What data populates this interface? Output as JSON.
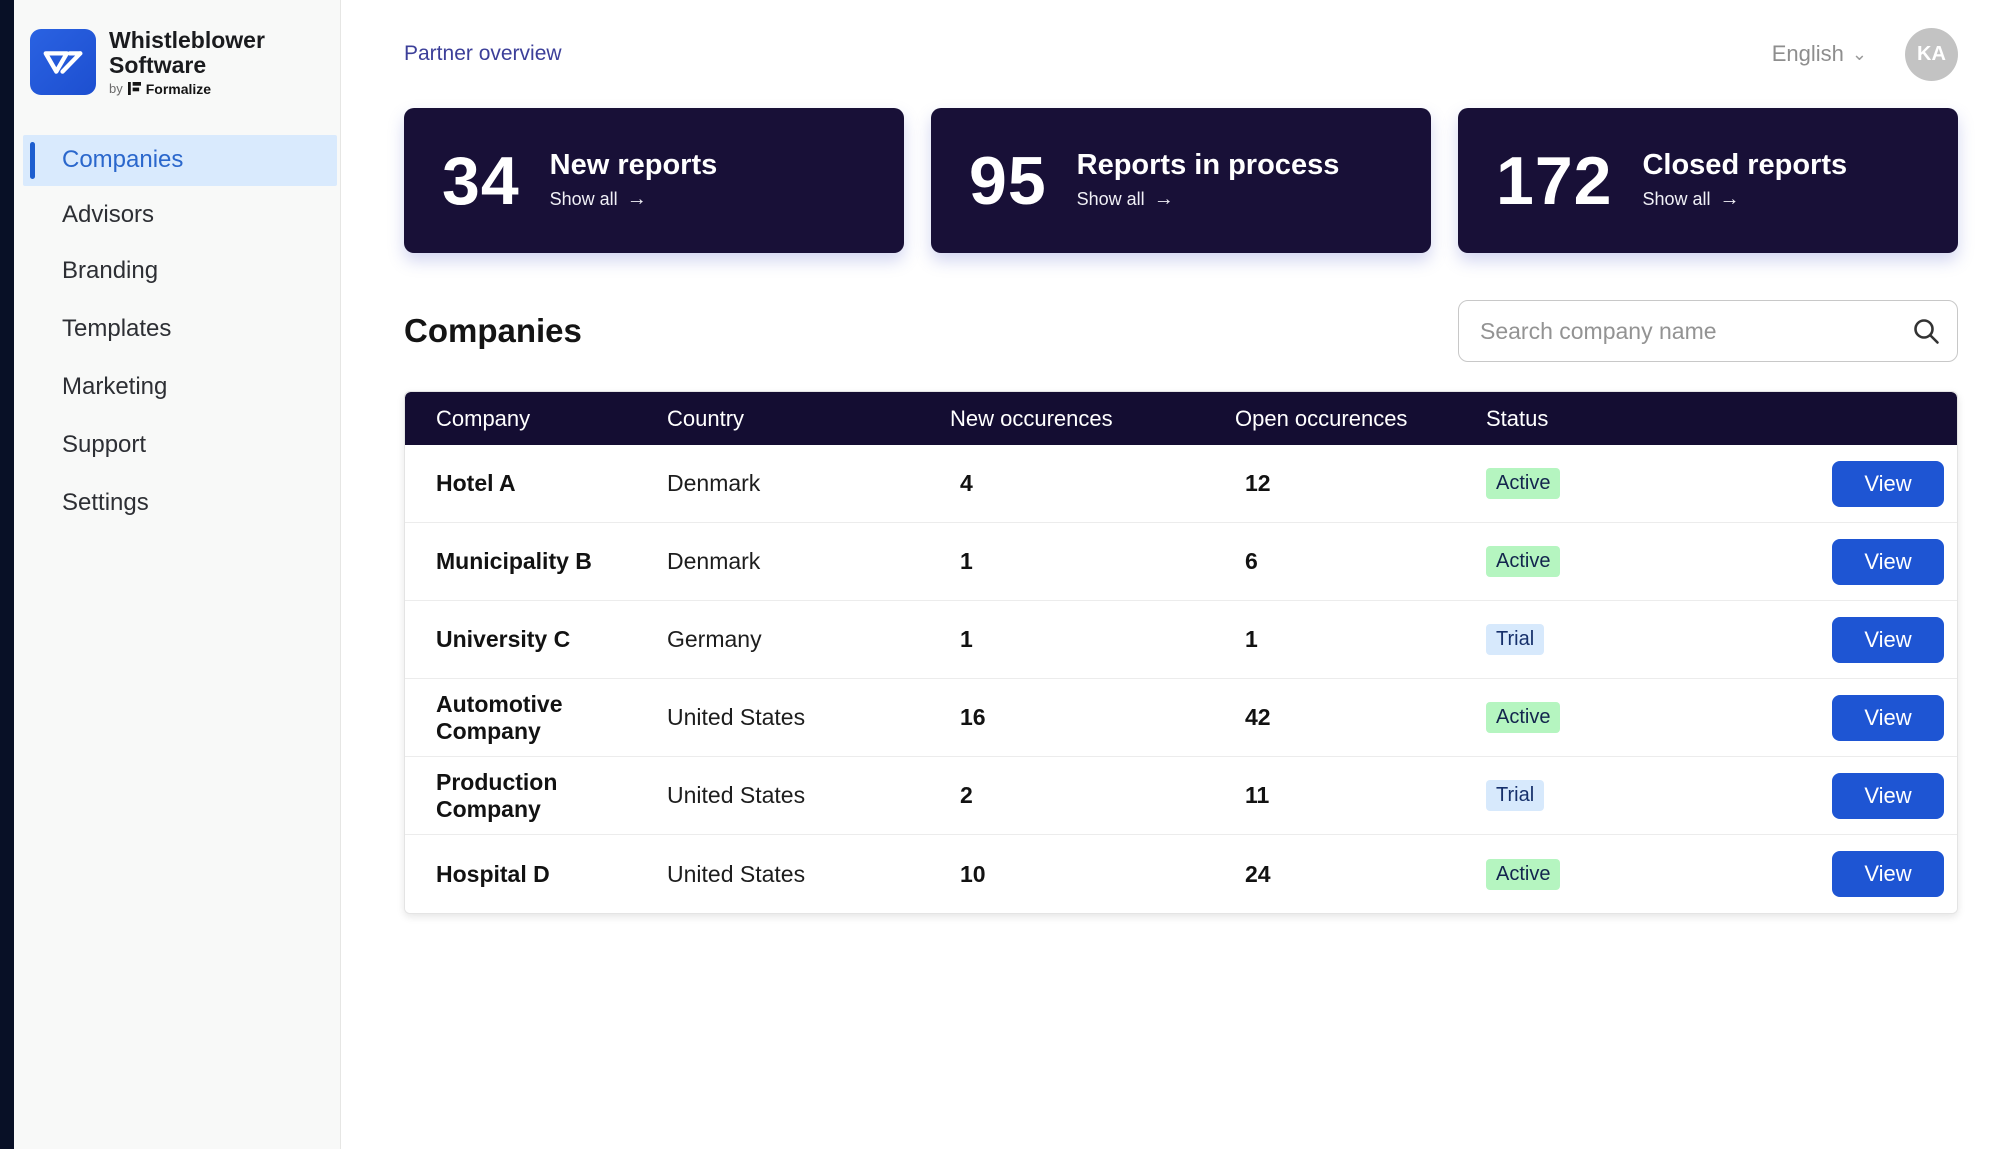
{
  "brand": {
    "name_line1": "Whistleblower",
    "name_line2": "Software",
    "by_label": "by",
    "by_brand": "Formalize"
  },
  "header": {
    "breadcrumb": "Partner overview",
    "language": "English",
    "avatar_initials": "KA"
  },
  "icons": {
    "chevron_down": "⌄",
    "arrow_right": "→"
  },
  "sidebar": {
    "items": [
      {
        "label": "Companies",
        "state": "active"
      },
      {
        "label": "Advisors",
        "state": ""
      },
      {
        "label": "Branding",
        "state": ""
      },
      {
        "label": "Templates",
        "state": ""
      },
      {
        "label": "Marketing",
        "state": ""
      },
      {
        "label": "Support",
        "state": ""
      },
      {
        "label": "Settings",
        "state": ""
      }
    ]
  },
  "stat_cards": [
    {
      "value": "34",
      "label": "New reports",
      "link": "Show all"
    },
    {
      "value": "95",
      "label": "Reports in process",
      "link": "Show all"
    },
    {
      "value": "172",
      "label": "Closed reports",
      "link": "Show all"
    }
  ],
  "companies_section": {
    "title": "Companies",
    "search_placeholder": "Search company name"
  },
  "table": {
    "columns": [
      "Company",
      "Country",
      "New occurences",
      "Open occurences",
      "Status"
    ],
    "rows": [
      {
        "company": "Hotel A",
        "country": "Denmark",
        "new_occurences": "4",
        "open_occurences": "12",
        "status": "Active",
        "action": "View"
      },
      {
        "company": "Municipality B",
        "country": "Denmark",
        "new_occurences": "1",
        "open_occurences": "6",
        "status": "Active",
        "action": "View"
      },
      {
        "company": "University C",
        "country": "Germany",
        "new_occurences": "1",
        "open_occurences": "1",
        "status": "Trial",
        "action": "View"
      },
      {
        "company": "Automotive Company",
        "country": "United States",
        "new_occurences": "16",
        "open_occurences": "42",
        "status": "Active",
        "action": "View"
      },
      {
        "company": "Production Company",
        "country": "United States",
        "new_occurences": "2",
        "open_occurences": "11",
        "status": "Trial",
        "action": "View"
      },
      {
        "company": "Hospital D",
        "country": "United States",
        "new_occurences": "10",
        "open_occurences": "24",
        "status": "Active",
        "action": "View"
      }
    ]
  },
  "colors": {
    "dark_navy": "#140d32",
    "card_navy": "#181037",
    "accent_blue": "#1e55d3",
    "sidebar_active_bg": "#d9eafd",
    "sidebar_active_text": "#2a67cc",
    "status_active_bg": "#b5f5c0",
    "status_trial_bg": "#d7e9fc",
    "avatar_gray": "#c3c3c3"
  }
}
